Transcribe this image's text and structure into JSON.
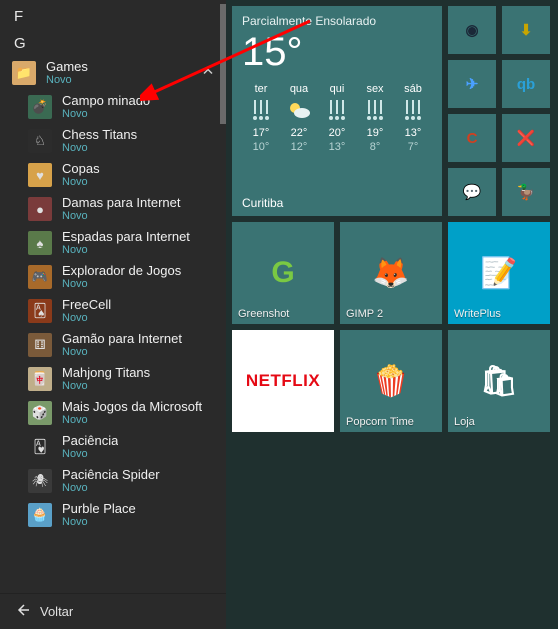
{
  "letters": {
    "f": "F",
    "g": "G"
  },
  "folder": {
    "label": "Games",
    "sub": "Novo"
  },
  "apps": [
    {
      "label": "Campo minado",
      "sub": "Novo",
      "bg": "#3a6a52",
      "glyph": "💣"
    },
    {
      "label": "Chess Titans",
      "sub": "Novo",
      "bg": "#2c2c2c",
      "glyph": "♘"
    },
    {
      "label": "Copas",
      "sub": "Novo",
      "bg": "#d7a24a",
      "glyph": "♥"
    },
    {
      "label": "Damas para Internet",
      "sub": "Novo",
      "bg": "#7a3b3b",
      "glyph": "●"
    },
    {
      "label": "Espadas para Internet",
      "sub": "Novo",
      "bg": "#5a7a4a",
      "glyph": "♠"
    },
    {
      "label": "Explorador de Jogos",
      "sub": "Novo",
      "bg": "#a86a2a",
      "glyph": "🎮"
    },
    {
      "label": "FreeCell",
      "sub": "Novo",
      "bg": "#8a3a1a",
      "glyph": "🂡"
    },
    {
      "label": "Gamão para Internet",
      "sub": "Novo",
      "bg": "#7a5a3a",
      "glyph": "⚅"
    },
    {
      "label": "Mahjong Titans",
      "sub": "Novo",
      "bg": "#bfae8a",
      "glyph": "🀄"
    },
    {
      "label": "Mais Jogos da Microsoft",
      "sub": "Novo",
      "bg": "#7a9a6a",
      "glyph": "🎲"
    },
    {
      "label": "Paciência",
      "sub": "Novo",
      "bg": "#2a2a2a",
      "glyph": "🂱"
    },
    {
      "label": "Paciência Spider",
      "sub": "Novo",
      "bg": "#3a3a3a",
      "glyph": "🕷"
    },
    {
      "label": "Purble Place",
      "sub": "Novo",
      "bg": "#5aa0c8",
      "glyph": "🧁"
    }
  ],
  "back": "Voltar",
  "weather": {
    "condition": "Parcialmente Ensolarado",
    "temp": "15°",
    "city": "Curitiba",
    "days": [
      {
        "d": "ter",
        "hi": "17°",
        "lo": "10°",
        "icon": "rain"
      },
      {
        "d": "qua",
        "hi": "22°",
        "lo": "12°",
        "icon": "partly"
      },
      {
        "d": "qui",
        "hi": "20°",
        "lo": "13°",
        "icon": "rain"
      },
      {
        "d": "sex",
        "hi": "19°",
        "lo": "8°",
        "icon": "rain"
      },
      {
        "d": "sáb",
        "hi": "13°",
        "lo": "7°",
        "icon": "rain"
      }
    ]
  },
  "small_tiles": [
    {
      "name": "steam",
      "bg": "#3a7373",
      "fg": "#1b2838",
      "glyph": "◉"
    },
    {
      "name": "jdownloader",
      "bg": "#3a7373",
      "fg": "#c7a500",
      "glyph": "⬇"
    },
    {
      "name": "plane",
      "bg": "#3a7373",
      "fg": "#4aa0ff",
      "glyph": "✈"
    },
    {
      "name": "qbittorrent",
      "bg": "#3a7373",
      "fg": "#2aa0d8",
      "glyph": "qb"
    },
    {
      "name": "ccleaner",
      "bg": "#3a7373",
      "fg": "#d04020",
      "glyph": "C"
    },
    {
      "name": "tool",
      "bg": "#3a7373",
      "fg": "#d08030",
      "glyph": "❌"
    },
    {
      "name": "chat",
      "bg": "#3a7373",
      "fg": "#4ab8ff",
      "glyph": "💬"
    },
    {
      "name": "duck",
      "bg": "#3a7373",
      "fg": "#f0c040",
      "glyph": "🦆"
    }
  ],
  "medium_tiles": [
    {
      "name": "greenshot",
      "label": "Greenshot",
      "bg": "#3a7373",
      "glyph": "G",
      "glyph_color": "#7ac943"
    },
    {
      "name": "gimp",
      "label": "GIMP 2",
      "bg": "#3a7373",
      "glyph": "🦊",
      "glyph_color": "#a07850"
    },
    {
      "name": "writeplus",
      "label": "WritePlus",
      "bg": "#00a0c8",
      "glyph": "📝",
      "glyph_color": "#ffffff"
    },
    {
      "name": "netflix",
      "label": "",
      "bg": "#ffffff",
      "glyph": "NETFLIX",
      "glyph_color": "#e50914"
    },
    {
      "name": "popcorn-time",
      "label": "Popcorn Time",
      "bg": "#3a7373",
      "glyph": "🍿",
      "glyph_color": "#e07040"
    },
    {
      "name": "store",
      "label": "Loja",
      "bg": "#3a7373",
      "glyph": "🛍",
      "glyph_color": "#ffffff"
    }
  ]
}
